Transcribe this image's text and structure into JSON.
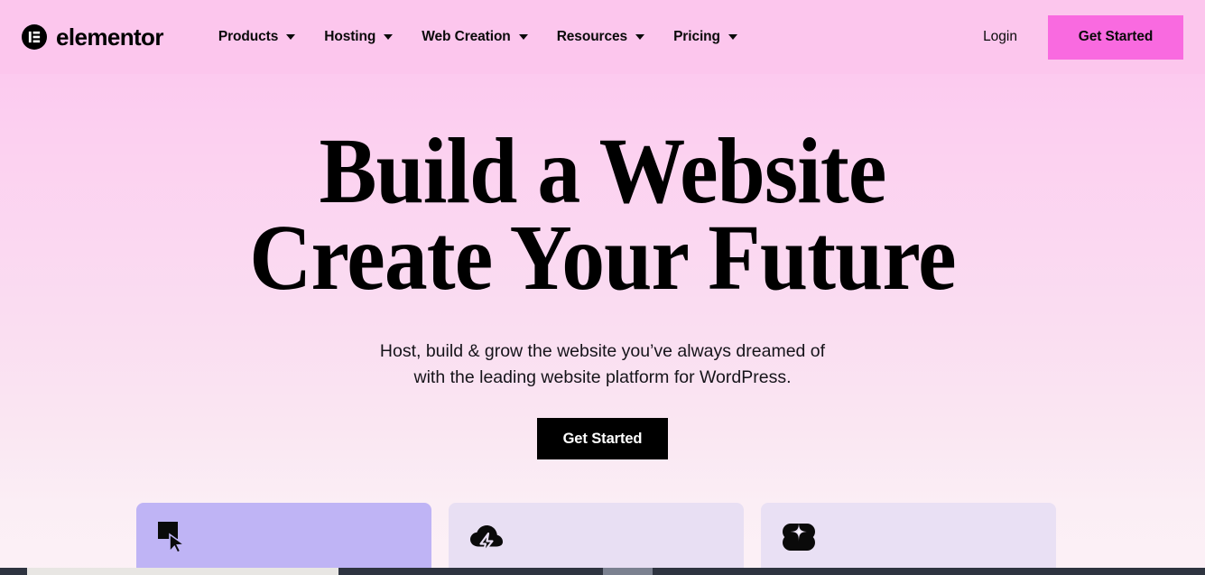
{
  "header": {
    "brand_name": "elementor",
    "brand_icon": "elementor-logo-icon",
    "nav": [
      {
        "label": "Products",
        "icon": "chevron-down-icon"
      },
      {
        "label": "Hosting",
        "icon": "chevron-down-icon"
      },
      {
        "label": "Web Creation",
        "icon": "chevron-down-icon"
      },
      {
        "label": "Resources",
        "icon": "chevron-down-icon"
      },
      {
        "label": "Pricing",
        "icon": "chevron-down-icon"
      }
    ],
    "login_label": "Login",
    "cta_label": "Get Started",
    "cta_color": "#f96ae0",
    "background_color": "#fcc6ed"
  },
  "hero": {
    "title_line1": "Build a Website",
    "title_line2": "Create Your Future",
    "subtitle_line1": "Host, build & grow the website you’ve always dreamed of",
    "subtitle_line2": "with the leading website platform for WordPress.",
    "cta_label": "Get Started",
    "cta_background": "#000000",
    "cta_text_color": "#ffffff"
  },
  "cards": [
    {
      "icon": "cursor-square-icon",
      "background": "#bfb4f5"
    },
    {
      "icon": "cloud-lightning-icon",
      "background": "#e8dff3"
    },
    {
      "icon": "ai-sparkle-icon",
      "background": "#e9e0f4"
    }
  ],
  "scrollbar": {
    "orientation": "horizontal",
    "track_color": "#2e3440",
    "thumb_color": "#e8e6e3"
  }
}
